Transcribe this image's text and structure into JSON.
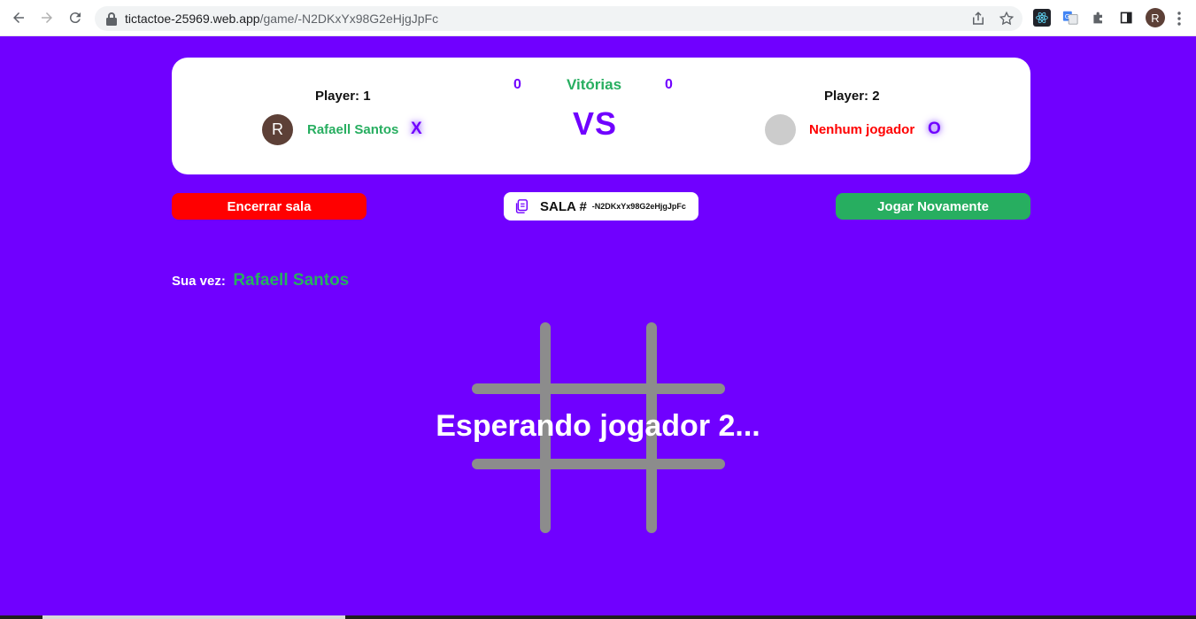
{
  "browser": {
    "url_host": "tictactoe-25969.web.app",
    "url_path": "/game/-N2DKxYx98G2eHjgJpFc",
    "profile_initial": "R"
  },
  "scoreboard": {
    "wins_label": "Vitórias",
    "vs_label": "VS",
    "player1": {
      "label": "Player: 1",
      "avatar_initial": "R",
      "name": "Rafaell Santos",
      "mark": "X",
      "wins": "0",
      "name_color": "#27ae60",
      "avatar_color": "#5d4037"
    },
    "player2": {
      "label": "Player: 2",
      "avatar_initial": "",
      "name": "Nenhum jogador",
      "mark": "O",
      "wins": "0",
      "name_color": "#ff0000",
      "avatar_color": "#cccccc"
    }
  },
  "actions": {
    "end_room_label": "Encerrar sala",
    "play_again_label": "Jogar Novamente",
    "room_label": "SALA #",
    "room_id": "-N2DKxYx98G2eHjgJpFc"
  },
  "turn": {
    "label": "Sua vez:",
    "player_name": "Rafaell Santos"
  },
  "board": {
    "status": "Esperando jogador 2..."
  },
  "colors": {
    "background": "#7000ff",
    "accent_green": "#27ae60",
    "accent_red": "#ff0000",
    "board_lines": "#8c8c8c"
  }
}
